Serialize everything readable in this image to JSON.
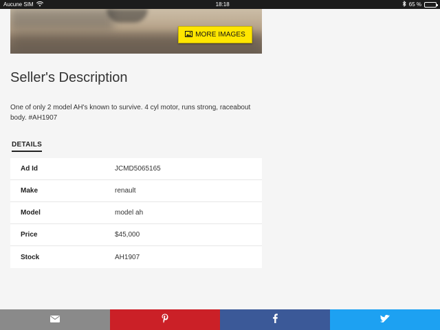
{
  "status_bar": {
    "carrier": "Aucune SIM",
    "time": "18:18",
    "battery_text": "65 %",
    "battery_level": 0.65
  },
  "photo": {
    "more_images_label": "MORE IMAGES"
  },
  "listing": {
    "title": "Seller's Description",
    "description": "One of only 2 model AH's known to survive. 4 cyl motor, runs strong, raceabout body. #AH1907",
    "details_tab": "DETAILS",
    "details": [
      {
        "key": "Ad Id",
        "value": "JCMD5065165"
      },
      {
        "key": "Make",
        "value": "renault"
      },
      {
        "key": "Model",
        "value": "model ah"
      },
      {
        "key": "Price",
        "value": "$45,000"
      },
      {
        "key": "Stock",
        "value": "AH1907"
      }
    ]
  },
  "share_bar": {
    "buttons": [
      {
        "name": "email",
        "icon": "envelope-icon",
        "color": "#8a8a8a"
      },
      {
        "name": "pinterest",
        "icon": "pinterest-icon",
        "color": "#cb2027"
      },
      {
        "name": "facebook",
        "icon": "facebook-icon",
        "color": "#3b5998"
      },
      {
        "name": "twitter",
        "icon": "twitter-icon",
        "color": "#1da1f2"
      }
    ]
  }
}
